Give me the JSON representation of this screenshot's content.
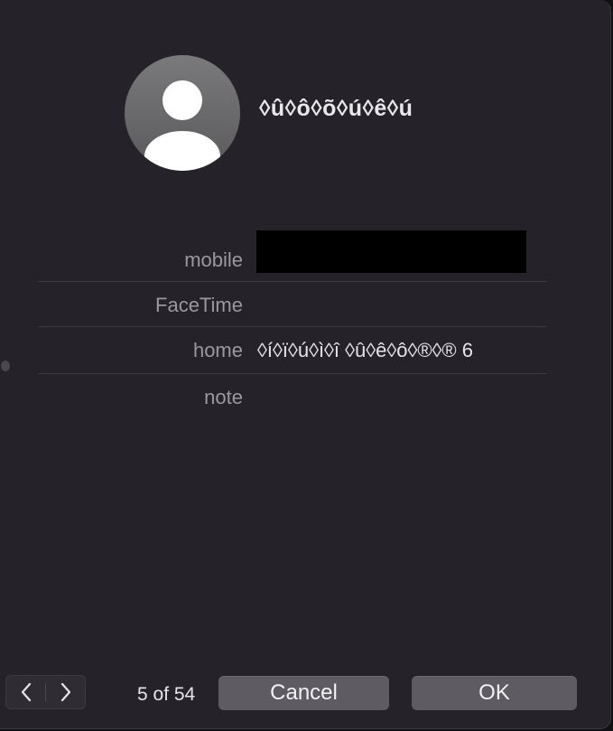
{
  "contact": {
    "name": "◊û◊ô◊õ◊ú◊ê◊ú"
  },
  "fields": [
    {
      "label": "mobile",
      "value": ""
    },
    {
      "label": "FaceTime",
      "value": ""
    },
    {
      "label": "home",
      "value": "◊í◊ï◊ú◊ì◊î ◊û◊ê◊ô◊®◊® 6"
    },
    {
      "label": "note",
      "value": ""
    }
  ],
  "footer": {
    "counter": "5 of 54",
    "cancel_label": "Cancel",
    "ok_label": "OK"
  },
  "icons": {
    "avatar": "person-silhouette-icon",
    "prev": "chevron-left-icon",
    "next": "chevron-right-icon"
  },
  "colors": {
    "panel_bg": "#252329",
    "button_bg": "#5e5c62",
    "label_text": "#9a999e",
    "value_text": "#e6e6e8",
    "redaction": "#000000"
  }
}
